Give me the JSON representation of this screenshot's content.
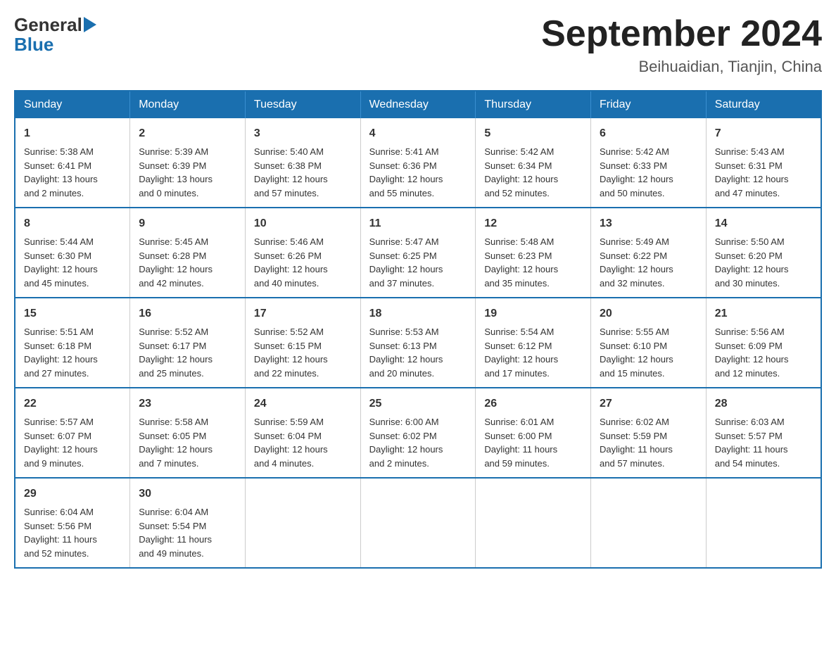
{
  "logo": {
    "general": "General",
    "blue": "Blue",
    "arrow": "▶"
  },
  "title": "September 2024",
  "subtitle": "Beihuaidian, Tianjin, China",
  "days_header": [
    "Sunday",
    "Monday",
    "Tuesday",
    "Wednesday",
    "Thursday",
    "Friday",
    "Saturday"
  ],
  "weeks": [
    [
      {
        "day": "1",
        "info": "Sunrise: 5:38 AM\nSunset: 6:41 PM\nDaylight: 13 hours\nand 2 minutes."
      },
      {
        "day": "2",
        "info": "Sunrise: 5:39 AM\nSunset: 6:39 PM\nDaylight: 13 hours\nand 0 minutes."
      },
      {
        "day": "3",
        "info": "Sunrise: 5:40 AM\nSunset: 6:38 PM\nDaylight: 12 hours\nand 57 minutes."
      },
      {
        "day": "4",
        "info": "Sunrise: 5:41 AM\nSunset: 6:36 PM\nDaylight: 12 hours\nand 55 minutes."
      },
      {
        "day": "5",
        "info": "Sunrise: 5:42 AM\nSunset: 6:34 PM\nDaylight: 12 hours\nand 52 minutes."
      },
      {
        "day": "6",
        "info": "Sunrise: 5:42 AM\nSunset: 6:33 PM\nDaylight: 12 hours\nand 50 minutes."
      },
      {
        "day": "7",
        "info": "Sunrise: 5:43 AM\nSunset: 6:31 PM\nDaylight: 12 hours\nand 47 minutes."
      }
    ],
    [
      {
        "day": "8",
        "info": "Sunrise: 5:44 AM\nSunset: 6:30 PM\nDaylight: 12 hours\nand 45 minutes."
      },
      {
        "day": "9",
        "info": "Sunrise: 5:45 AM\nSunset: 6:28 PM\nDaylight: 12 hours\nand 42 minutes."
      },
      {
        "day": "10",
        "info": "Sunrise: 5:46 AM\nSunset: 6:26 PM\nDaylight: 12 hours\nand 40 minutes."
      },
      {
        "day": "11",
        "info": "Sunrise: 5:47 AM\nSunset: 6:25 PM\nDaylight: 12 hours\nand 37 minutes."
      },
      {
        "day": "12",
        "info": "Sunrise: 5:48 AM\nSunset: 6:23 PM\nDaylight: 12 hours\nand 35 minutes."
      },
      {
        "day": "13",
        "info": "Sunrise: 5:49 AM\nSunset: 6:22 PM\nDaylight: 12 hours\nand 32 minutes."
      },
      {
        "day": "14",
        "info": "Sunrise: 5:50 AM\nSunset: 6:20 PM\nDaylight: 12 hours\nand 30 minutes."
      }
    ],
    [
      {
        "day": "15",
        "info": "Sunrise: 5:51 AM\nSunset: 6:18 PM\nDaylight: 12 hours\nand 27 minutes."
      },
      {
        "day": "16",
        "info": "Sunrise: 5:52 AM\nSunset: 6:17 PM\nDaylight: 12 hours\nand 25 minutes."
      },
      {
        "day": "17",
        "info": "Sunrise: 5:52 AM\nSunset: 6:15 PM\nDaylight: 12 hours\nand 22 minutes."
      },
      {
        "day": "18",
        "info": "Sunrise: 5:53 AM\nSunset: 6:13 PM\nDaylight: 12 hours\nand 20 minutes."
      },
      {
        "day": "19",
        "info": "Sunrise: 5:54 AM\nSunset: 6:12 PM\nDaylight: 12 hours\nand 17 minutes."
      },
      {
        "day": "20",
        "info": "Sunrise: 5:55 AM\nSunset: 6:10 PM\nDaylight: 12 hours\nand 15 minutes."
      },
      {
        "day": "21",
        "info": "Sunrise: 5:56 AM\nSunset: 6:09 PM\nDaylight: 12 hours\nand 12 minutes."
      }
    ],
    [
      {
        "day": "22",
        "info": "Sunrise: 5:57 AM\nSunset: 6:07 PM\nDaylight: 12 hours\nand 9 minutes."
      },
      {
        "day": "23",
        "info": "Sunrise: 5:58 AM\nSunset: 6:05 PM\nDaylight: 12 hours\nand 7 minutes."
      },
      {
        "day": "24",
        "info": "Sunrise: 5:59 AM\nSunset: 6:04 PM\nDaylight: 12 hours\nand 4 minutes."
      },
      {
        "day": "25",
        "info": "Sunrise: 6:00 AM\nSunset: 6:02 PM\nDaylight: 12 hours\nand 2 minutes."
      },
      {
        "day": "26",
        "info": "Sunrise: 6:01 AM\nSunset: 6:00 PM\nDaylight: 11 hours\nand 59 minutes."
      },
      {
        "day": "27",
        "info": "Sunrise: 6:02 AM\nSunset: 5:59 PM\nDaylight: 11 hours\nand 57 minutes."
      },
      {
        "day": "28",
        "info": "Sunrise: 6:03 AM\nSunset: 5:57 PM\nDaylight: 11 hours\nand 54 minutes."
      }
    ],
    [
      {
        "day": "29",
        "info": "Sunrise: 6:04 AM\nSunset: 5:56 PM\nDaylight: 11 hours\nand 52 minutes."
      },
      {
        "day": "30",
        "info": "Sunrise: 6:04 AM\nSunset: 5:54 PM\nDaylight: 11 hours\nand 49 minutes."
      },
      {
        "day": "",
        "info": ""
      },
      {
        "day": "",
        "info": ""
      },
      {
        "day": "",
        "info": ""
      },
      {
        "day": "",
        "info": ""
      },
      {
        "day": "",
        "info": ""
      }
    ]
  ]
}
